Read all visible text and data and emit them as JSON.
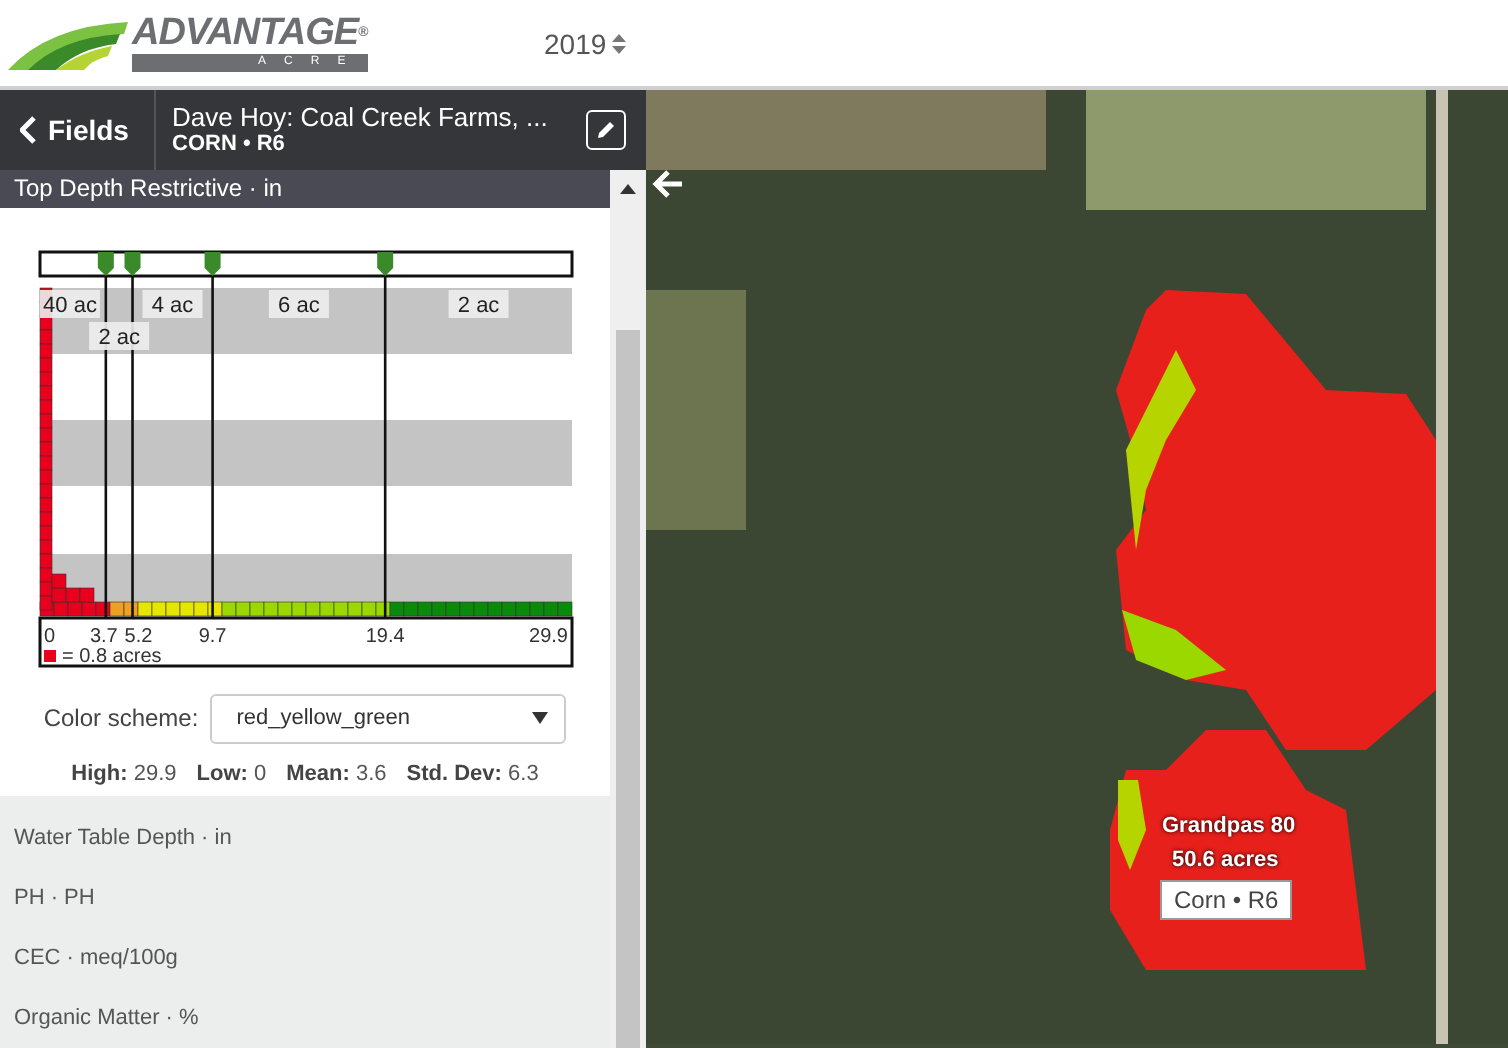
{
  "header": {
    "logo": {
      "name": "ADVANTAGE",
      "mark": "®",
      "sub": "ACRE"
    },
    "year": "2019"
  },
  "nav": {
    "back": "Fields",
    "title": "Dave Hoy: Coal Creek Farms, ...",
    "subtitle": "CORN • R6"
  },
  "layer": {
    "title": "Top Depth Restrictive · in",
    "histogram": {
      "min": "0",
      "max": "29.9",
      "breaks": [
        {
          "label": "3.7"
        },
        {
          "label": "5.2"
        },
        {
          "label": "9.7"
        },
        {
          "label": "19.4"
        }
      ],
      "ranges": [
        "40 ac",
        "2 ac",
        "4 ac",
        "6 ac",
        "2 ac"
      ],
      "legend": "= 0.8 acres"
    },
    "scheme": {
      "label": "Color scheme:",
      "value": "red_yellow_green"
    },
    "stats": [
      {
        "label": "High:",
        "value": "29.9"
      },
      {
        "label": "Low:",
        "value": "0"
      },
      {
        "label": "Mean:",
        "value": "3.6"
      },
      {
        "label": "Std. Dev:",
        "value": "6.3"
      }
    ]
  },
  "other_layers": [
    "Water Table Depth · in",
    "PH · PH",
    "CEC · meq/100g",
    "Organic Matter · %"
  ],
  "map": {
    "field_name": "Grandpas 80",
    "field_area": "50.6 acres",
    "crop_tag": "Corn • R6"
  }
}
